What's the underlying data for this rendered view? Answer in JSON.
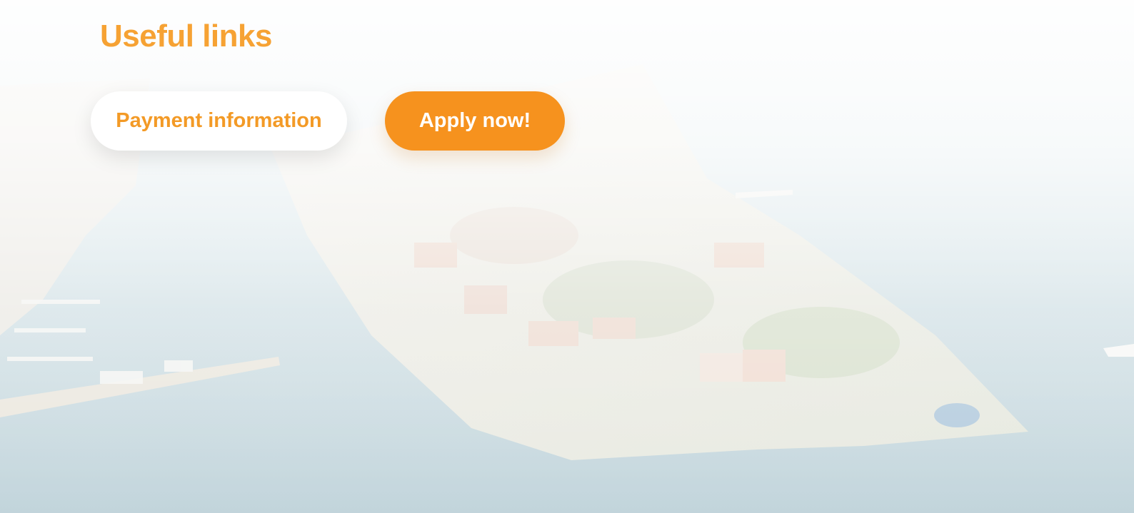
{
  "section": {
    "title": "Useful links"
  },
  "buttons": {
    "payment_label": "Payment information",
    "apply_label": "Apply now!"
  },
  "colors": {
    "accent": "#f6921e",
    "heading": "#f6a233",
    "button_text_secondary": "#f39a26",
    "button_bg_secondary": "#ffffff"
  },
  "background": {
    "image": "aerial-peninsula-city-photo"
  }
}
